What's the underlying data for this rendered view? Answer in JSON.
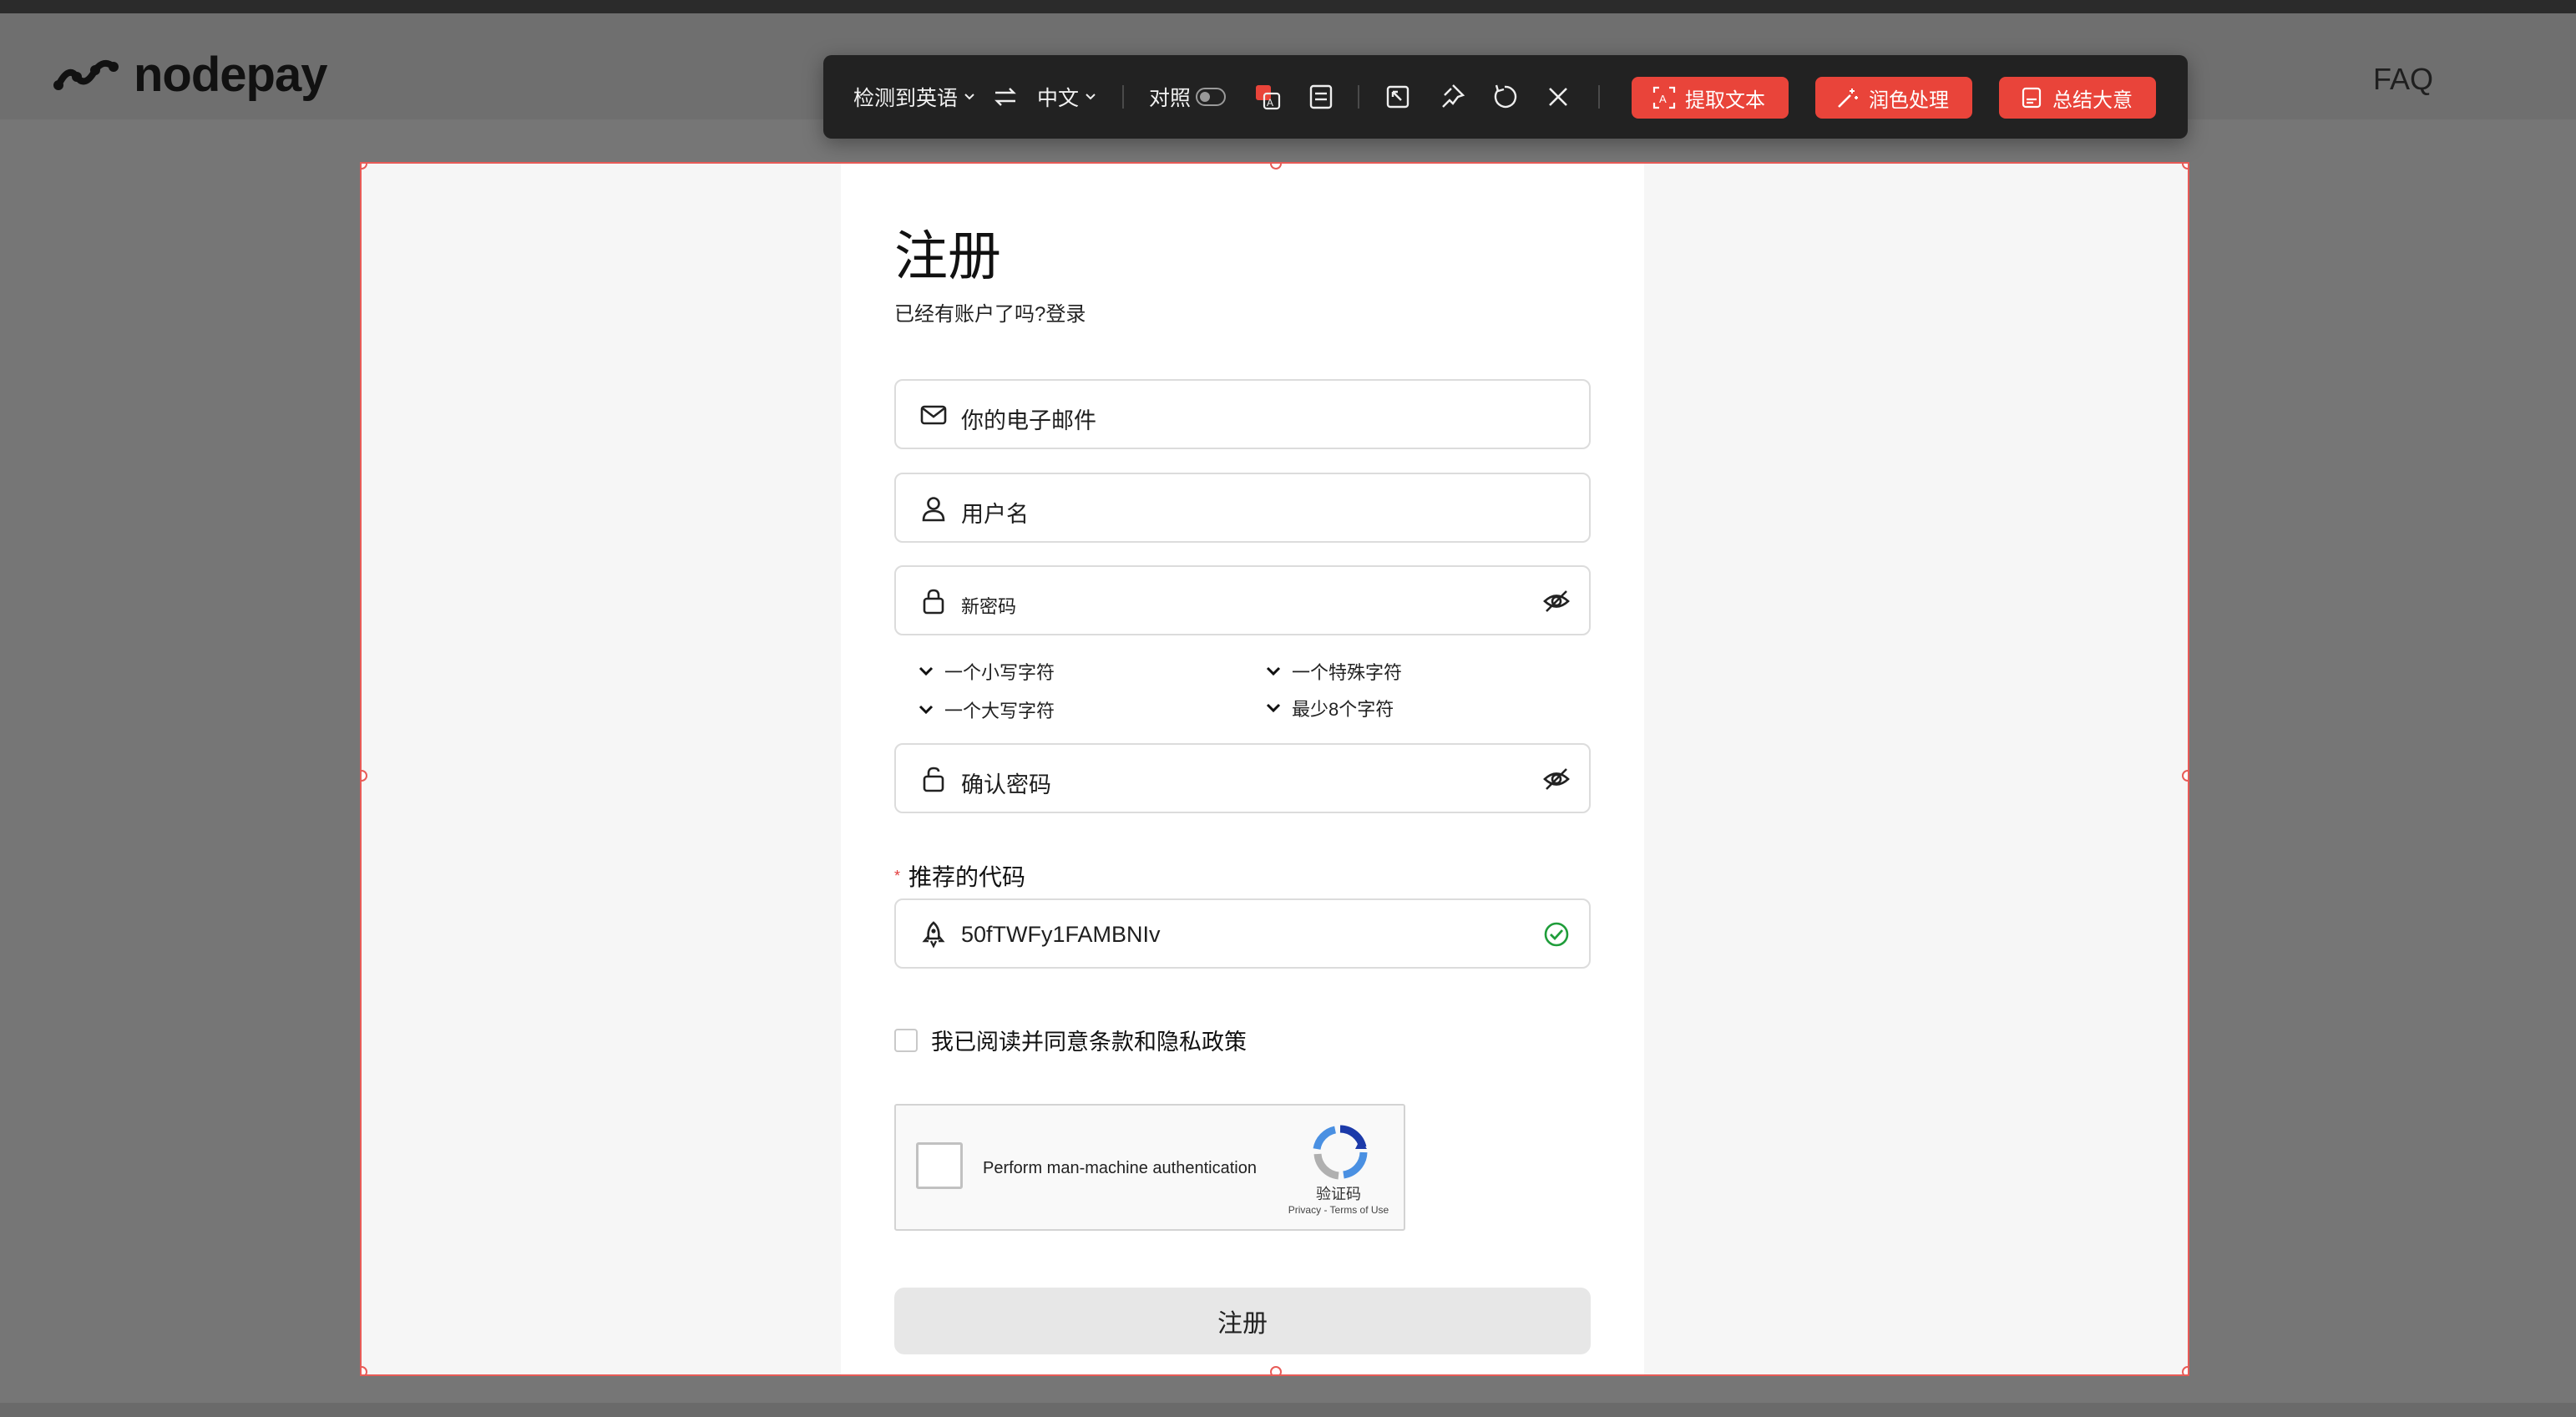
{
  "site": {
    "logo_text": "nodepay",
    "nav_faq": "FAQ"
  },
  "toolbar": {
    "source_lang": "检测到英语",
    "target_lang": "中文",
    "compare_label": "对照",
    "extract_text": "提取文本",
    "polish": "润色处理",
    "summarize": "总结大意"
  },
  "form": {
    "title": "注册",
    "subtitle": "已经有账户了吗?登录",
    "email_placeholder": "你的电子邮件",
    "username_placeholder": "用户名",
    "new_password_placeholder": "新密码",
    "rules": {
      "lowercase": "一个小写字符",
      "special": "一个特殊字符",
      "uppercase": "一个大写字符",
      "min_length": "最少8个字符"
    },
    "confirm_password_placeholder": "确认密码",
    "referral_label": "推荐的代码",
    "referral_required_mark": "*",
    "referral_value": "50fTWFy1FAMBNIv",
    "agree_text": "我已阅读并同意条款和隐私政策",
    "captcha": {
      "text": "Perform man-machine authentication",
      "name": "验证码",
      "links": "Privacy - Terms of Use"
    },
    "submit_label": "注册"
  },
  "colors": {
    "accent_red": "#e9443a",
    "selection_border": "#e85b57",
    "valid_green": "#1f9d3a"
  }
}
